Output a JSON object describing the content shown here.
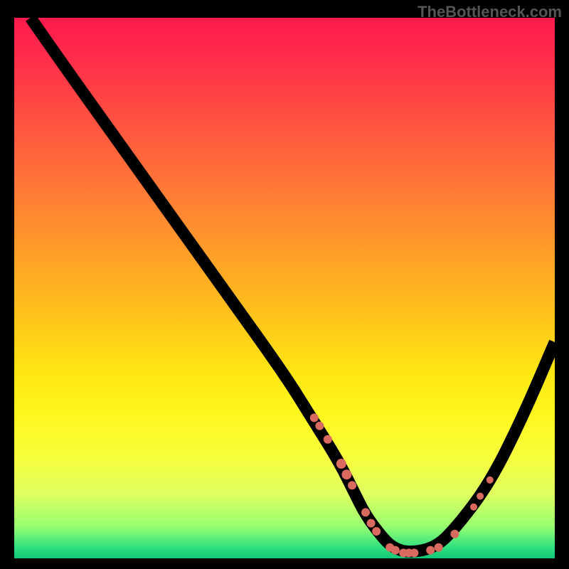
{
  "watermark": "TheBottleneck.com",
  "chart_data": {
    "type": "line",
    "title": "",
    "xlabel": "",
    "ylabel": "",
    "xlim": [
      0,
      100
    ],
    "ylim": [
      0,
      100
    ],
    "series": [
      {
        "name": "curve",
        "x": [
          3,
          10,
          20,
          30,
          40,
          50,
          55,
          60,
          63,
          65,
          68,
          70,
          73,
          78,
          82,
          88,
          94,
          100
        ],
        "y": [
          100,
          90,
          76,
          62,
          48,
          34,
          26,
          18,
          12,
          8,
          4,
          2,
          1,
          2,
          6,
          14,
          26,
          40
        ]
      }
    ],
    "markers": [
      {
        "x": 55.5,
        "y": 26.0,
        "r": 6
      },
      {
        "x": 56.5,
        "y": 24.5,
        "r": 6
      },
      {
        "x": 58.0,
        "y": 22.0,
        "r": 6
      },
      {
        "x": 60.5,
        "y": 17.5,
        "r": 7
      },
      {
        "x": 61.5,
        "y": 15.5,
        "r": 7
      },
      {
        "x": 62.5,
        "y": 13.5,
        "r": 6
      },
      {
        "x": 65.0,
        "y": 8.5,
        "r": 6
      },
      {
        "x": 66.0,
        "y": 6.5,
        "r": 6
      },
      {
        "x": 67.0,
        "y": 5.0,
        "r": 6
      },
      {
        "x": 69.5,
        "y": 2.0,
        "r": 6
      },
      {
        "x": 70.5,
        "y": 1.5,
        "r": 6
      },
      {
        "x": 72.0,
        "y": 1.0,
        "r": 6
      },
      {
        "x": 73.0,
        "y": 1.0,
        "r": 6
      },
      {
        "x": 74.0,
        "y": 1.0,
        "r": 6
      },
      {
        "x": 77.0,
        "y": 1.5,
        "r": 6
      },
      {
        "x": 78.5,
        "y": 2.0,
        "r": 6
      },
      {
        "x": 81.5,
        "y": 4.5,
        "r": 6
      },
      {
        "x": 85.0,
        "y": 9.5,
        "r": 5
      },
      {
        "x": 86.2,
        "y": 11.5,
        "r": 5
      },
      {
        "x": 88.0,
        "y": 14.5,
        "r": 5
      }
    ],
    "gradient_colors": {
      "top": "#ff1a4d",
      "mid_upper": "#ff7a36",
      "mid": "#ffe812",
      "mid_lower": "#e0ff60",
      "bottom": "#10c878"
    }
  }
}
